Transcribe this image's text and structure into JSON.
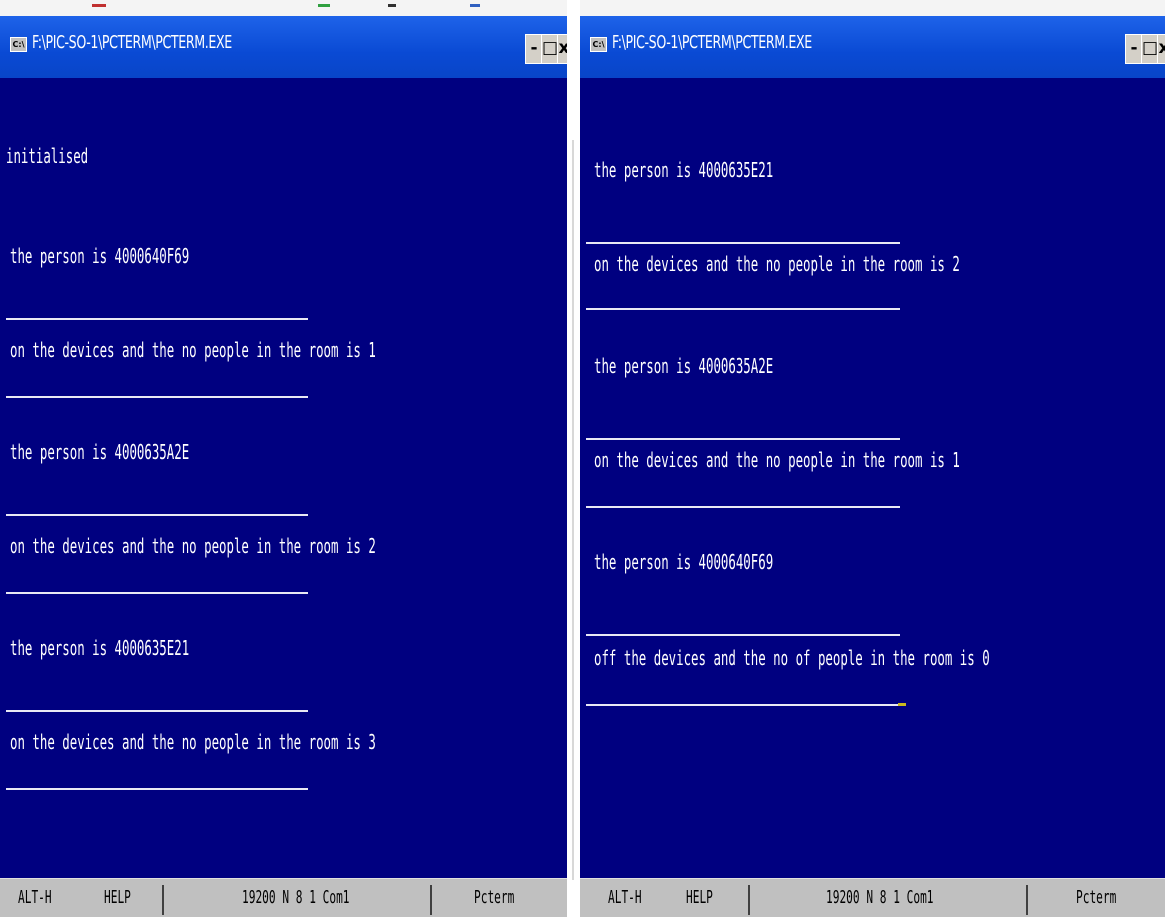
{
  "left_window": {
    "title": "F:\\PIC-SO-1\\PCTERM\\PCTERM.EXE",
    "lines": [
      "initialised",
      "the person is 4000640F69",
      "on the devices and the no people in the room is 1",
      "the person is 4000635A2E",
      "on the devices and the no people in the room is 2",
      "the person is 4000635E21",
      "on the devices and the no people in the room is 3"
    ],
    "status": {
      "key": "ALT-H",
      "help": "HELP",
      "comm": "19200 N 8 1 Com1",
      "app": "Pcterm"
    }
  },
  "right_window": {
    "title": "F:\\PIC-SO-1\\PCTERM\\PCTERM.EXE",
    "lines": [
      "the person is 4000635E21",
      "on the devices and the no people in the room is 2",
      "the person is 4000635A2E",
      "on the devices and the no people in the room is 1",
      "the person is 4000640F69",
      "off the devices and the no of people in the room is 0"
    ],
    "status": {
      "key": "ALT-H",
      "help": "HELP",
      "comm": "19200 N 8 1 Com1",
      "app": "Pcterm"
    }
  },
  "controls": {
    "minimize": "-",
    "maximize": "□",
    "close": "x"
  },
  "icons": {
    "window": "console-window-icon"
  },
  "colors": {
    "terminal_bg": "#000080",
    "terminal_text": "#ffffff",
    "titlebar": "#0a4ad4",
    "statusbar": "#c0c0c0"
  }
}
